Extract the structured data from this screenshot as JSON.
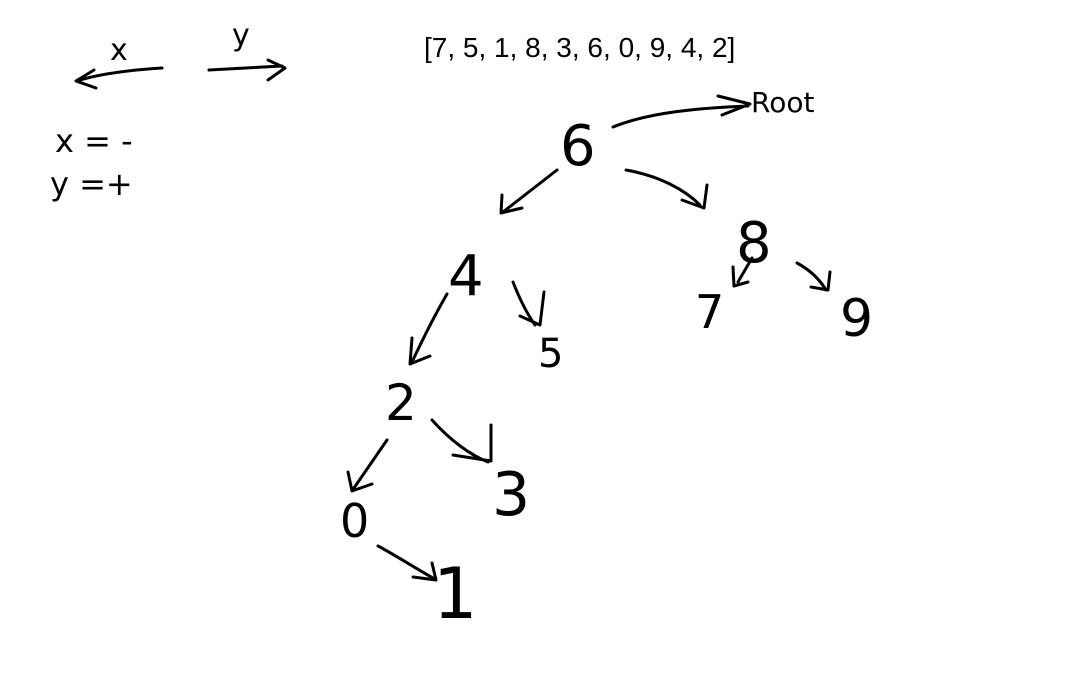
{
  "array_label": "[7, 5, 1, 8, 3, 6, 0, 9, 4, 2]",
  "legend": {
    "x_label": "x",
    "y_label": "y",
    "x_rule": "x = -",
    "y_rule": "y =+"
  },
  "root_label": "Root",
  "nodes": {
    "n6": "6",
    "n4": "4",
    "n8": "8",
    "n2": "2",
    "n5": "5",
    "n7": "7",
    "n9": "9",
    "n0": "0",
    "n3": "3",
    "n1": "1"
  },
  "edges": [
    [
      "n6",
      "n4"
    ],
    [
      "n6",
      "n8"
    ],
    [
      "n4",
      "n2"
    ],
    [
      "n4",
      "n5"
    ],
    [
      "n8",
      "n7"
    ],
    [
      "n8",
      "n9"
    ],
    [
      "n2",
      "n0"
    ],
    [
      "n2",
      "n3"
    ],
    [
      "n0",
      "n1"
    ]
  ]
}
